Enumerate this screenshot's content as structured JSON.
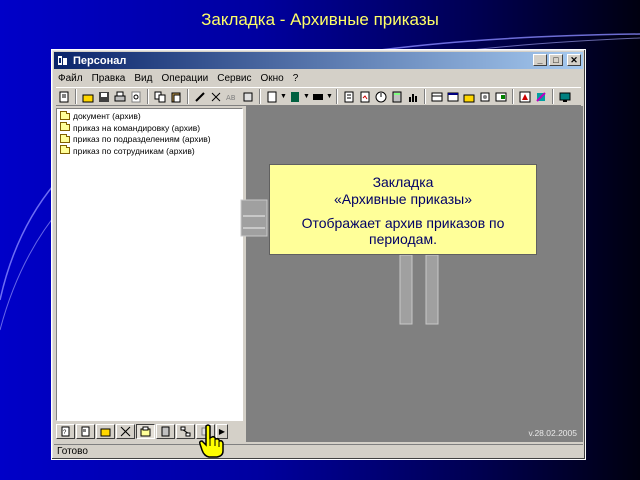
{
  "slide": {
    "title": "Закладка - Архивные приказы"
  },
  "window": {
    "title": "Персонал",
    "buttons": [
      "_",
      "□",
      "✕"
    ],
    "menu": [
      "Файл",
      "Правка",
      "Вид",
      "Операции",
      "Сервис",
      "Окно",
      "?"
    ],
    "toolbar_icons": [
      "new-doc-icon",
      "open-folder-icon",
      "save-icon",
      "print-icon",
      "preview-icon",
      "cut-icon",
      "copy-icon",
      "paste-icon",
      "undo-icon",
      "delete-icon",
      "find-icon",
      "replace-icon",
      "dropdown-icon",
      "view-icon",
      "dropdown-icon",
      "list-icon",
      "dropdown-icon",
      "properties-icon",
      "edit-icon",
      "timer-icon",
      "calculator-icon",
      "chart-icon",
      "journal-icon",
      "table-icon",
      "report-icon",
      "folder-icon",
      "calendar-icon",
      "settings-icon",
      "help-icon",
      "monitor-icon"
    ],
    "tree": [
      "документ (архив)",
      "приказ на командировку (архив)",
      "приказ по подразделениям (архив)",
      "приказ по сотрудникам (архив)"
    ],
    "tabs": [
      {
        "icon": "document-tab-icon"
      },
      {
        "icon": "card-tab-icon"
      },
      {
        "icon": "folder-tab-icon"
      },
      {
        "icon": "scissors-tab-icon"
      },
      {
        "icon": "archive-tab-icon",
        "active": true
      },
      {
        "icon": "calculator-tab-icon"
      },
      {
        "icon": "structure-tab-icon"
      },
      {
        "icon": "blank-tab-icon"
      },
      {
        "icon": "next-arrow-icon"
      }
    ],
    "version": "v.28.02.2005",
    "status": "Готово"
  },
  "callout": {
    "title": "Закладка",
    "subtitle": "«Архивные приказы»",
    "body": "Отображает архив приказов по периодам."
  },
  "colors": {
    "slide_title": "#ffff66",
    "callout_bg": "#ffff99",
    "titlebar_start": "#0a246a",
    "titlebar_end": "#a6caf0"
  }
}
